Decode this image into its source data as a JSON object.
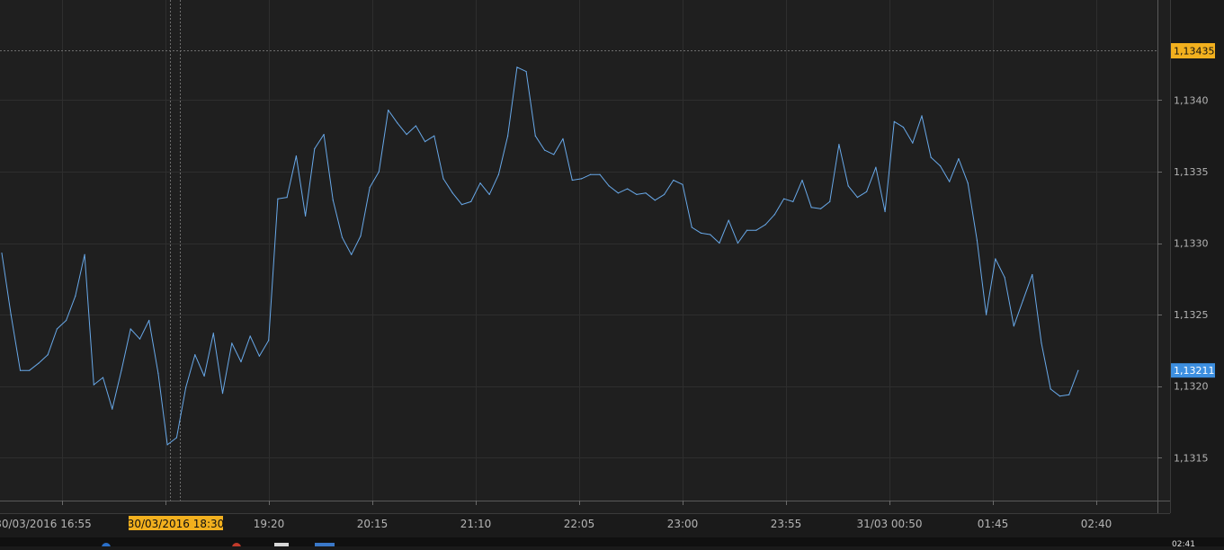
{
  "chart_data": {
    "type": "line",
    "ylim": [
      1.1312,
      1.1347
    ],
    "grid": true,
    "x_ticks": [
      "30/03/2016 16:55",
      "19:20",
      "20:15",
      "21:10",
      "22:05",
      "23:00",
      "23:55",
      "31/03 00:50",
      "01:45",
      "02:40"
    ],
    "y_ticks": [
      "1,1315",
      "1,1320",
      "1,1325",
      "1,1330",
      "1,1335",
      "1,1340"
    ],
    "y_tick_values": [
      1.1315,
      1.132,
      1.1325,
      1.133,
      1.1335,
      1.134
    ],
    "crosshair": {
      "x_label": "30/03/2016 18:30",
      "y_label": "1,13435",
      "y_value": 1.13435
    },
    "last_value_label": "1,13211",
    "last_value": 1.13211,
    "series": [
      {
        "values": [
          1.13293,
          1.1325,
          1.13211,
          1.13211,
          1.13216,
          1.13222,
          1.1324,
          1.13246,
          1.13263,
          1.13292,
          1.13201,
          1.13206,
          1.13184,
          1.13211,
          1.1324,
          1.13233,
          1.13246,
          1.13209,
          1.13159,
          1.13164,
          1.13199,
          1.13222,
          1.13207,
          1.13237,
          1.13195,
          1.1323,
          1.13217,
          1.13235,
          1.13221,
          1.13232,
          1.13331,
          1.13332,
          1.13361,
          1.13319,
          1.13366,
          1.13376,
          1.1333,
          1.13304,
          1.13292,
          1.13305,
          1.13339,
          1.1335,
          1.13393,
          1.13384,
          1.13376,
          1.13382,
          1.13371,
          1.13375,
          1.13345,
          1.13335,
          1.13327,
          1.13329,
          1.13342,
          1.13334,
          1.13348,
          1.13375,
          1.13423,
          1.1342,
          1.13375,
          1.13365,
          1.13362,
          1.13373,
          1.13344,
          1.13345,
          1.13348,
          1.13348,
          1.1334,
          1.13335,
          1.13338,
          1.13334,
          1.13335,
          1.1333,
          1.13334,
          1.13344,
          1.13341,
          1.13311,
          1.13307,
          1.13306,
          1.133,
          1.13316,
          1.133,
          1.13309,
          1.13309,
          1.13313,
          1.1332,
          1.13331,
          1.13329,
          1.13344,
          1.13325,
          1.13324,
          1.13329,
          1.13369,
          1.1334,
          1.13332,
          1.13336,
          1.13353,
          1.13322,
          1.13385,
          1.13381,
          1.1337,
          1.13389,
          1.1336,
          1.13354,
          1.13343,
          1.13359,
          1.13342,
          1.13302,
          1.1325,
          1.13289,
          1.13276,
          1.13242,
          1.1326,
          1.13278,
          1.1323,
          1.13198,
          1.13193,
          1.13194,
          1.13211
        ]
      }
    ]
  },
  "colors": {
    "background": "#1f1f1f",
    "outer_background": "#1a1a1a",
    "grid": "#2e2e2e",
    "line": "#68a8e8",
    "axis_text": "#b4b4b4",
    "crosshair_label_bg": "#f2b01e",
    "last_value_label_bg": "#3d8fe0"
  },
  "status": {
    "clock": "02:41"
  }
}
